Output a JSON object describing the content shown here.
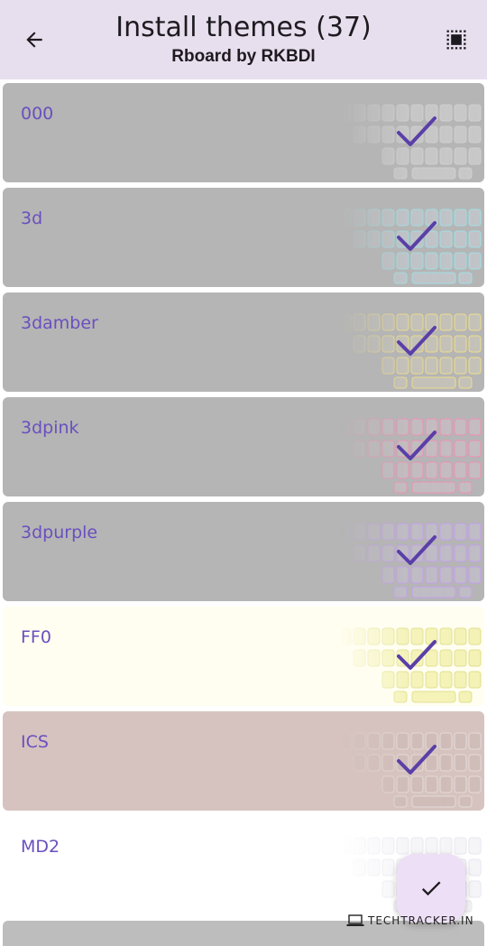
{
  "header": {
    "title": "Install themes (37)",
    "subtitle": "Rboard by RKBDI",
    "back_icon": "arrow-left-icon",
    "select_icon": "select-all-icon"
  },
  "themes": [
    {
      "name": "000",
      "bg": "#b5b5b5",
      "key": "#c8c8c8",
      "edge": "#d0d0d0",
      "selected": true
    },
    {
      "name": "3d",
      "bg": "#b5b5b5",
      "key": "#c0c4c8",
      "edge": "#9fe0e6",
      "selected": true
    },
    {
      "name": "3damber",
      "bg": "#b5b5b5",
      "key": "#c4c2b8",
      "edge": "#f0de8a",
      "selected": true
    },
    {
      "name": "3dpink",
      "bg": "#b5b5b5",
      "key": "#c4bcc0",
      "edge": "#f08fb4",
      "selected": true
    },
    {
      "name": "3dpurple",
      "bg": "#b5b5b5",
      "key": "#c0bcc6",
      "edge": "#c59ef0",
      "selected": true
    },
    {
      "name": "FF0",
      "bg": "#fffef0",
      "key": "#f4f2b4",
      "edge": "#e0df8c",
      "selected": true
    },
    {
      "name": "ICS",
      "bg": "#d6c3bf",
      "key": "#cfbcb8",
      "edge": "#e5dcd9",
      "selected": true
    },
    {
      "name": "MD2",
      "bg": "#ffffff",
      "key": "#f5f5f8",
      "edge": "#e6e6ef",
      "selected": false
    }
  ],
  "fab": {
    "icon": "check-icon"
  },
  "watermark": {
    "text": "TECHTRACKER.IN",
    "icon": "laptop-icon"
  },
  "colors": {
    "accent": "#6a4fbf",
    "appbar": "#e8dfee",
    "check": "#5a3fa8"
  }
}
